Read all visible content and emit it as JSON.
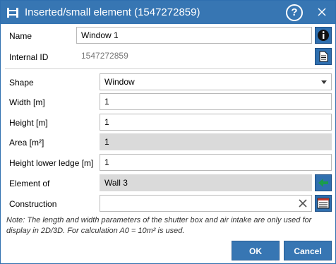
{
  "dialog": {
    "title": "Inserted/small element (1547272859)",
    "help_label": "?",
    "close_icon": "close-icon"
  },
  "form": {
    "name_label": "Name",
    "name_value": "Window 1",
    "internal_id_label": "Internal ID",
    "internal_id_value": "1547272859",
    "shape_label": "Shape",
    "shape_value": "Window",
    "width_label": "Width [m]",
    "width_value": "1",
    "height_label": "Height [m]",
    "height_value": "1",
    "area_label": "Area [m²]",
    "area_value": "1",
    "ledge_label": "Height lower ledge [m]",
    "ledge_value": "1",
    "element_of_label": "Element of",
    "element_of_value": "Wall 3",
    "construction_label": "Construction",
    "construction_value": ""
  },
  "note": "Note: The length and width parameters of the shutter box and air intake are only used for display in 2D/3D. For calculation A0 = 10m² is used.",
  "buttons": {
    "ok_label": "OK",
    "cancel_label": "Cancel"
  },
  "colors": {
    "accent": "#3776b3",
    "field_disabled": "#dadada",
    "arrow_green": "#1a9c4a"
  }
}
